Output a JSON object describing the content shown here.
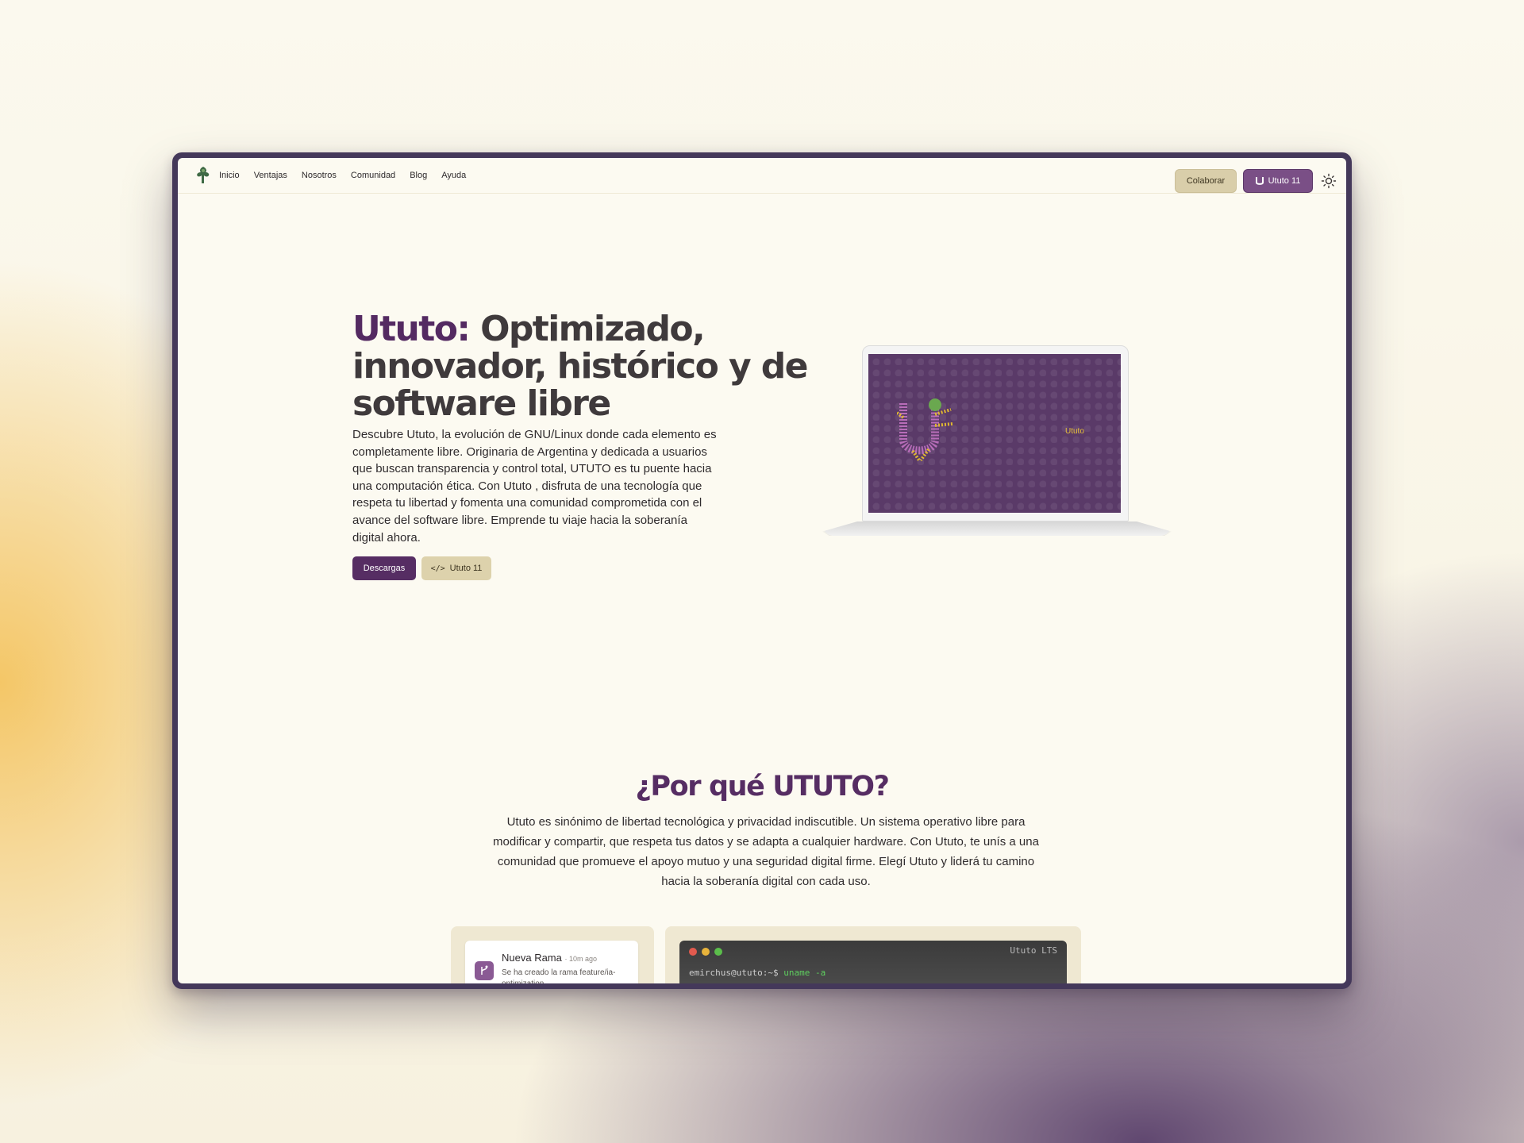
{
  "nav": {
    "logo_icon": "ututo-logo-icon",
    "links": [
      "Inicio",
      "Ventajas",
      "Nosotros",
      "Comunidad",
      "Blog",
      "Ayuda"
    ],
    "colaborar_label": "Colaborar",
    "ututo11_label": "Ututo 11",
    "theme_icon": "sun-icon"
  },
  "hero": {
    "title_accent": "Ututo:",
    "title_rest": "Optimizado, innovador, histórico y de software libre",
    "description": "Descubre Ututo, la evolución de GNU/Linux donde cada elemento es completamente libre. Originaria de Argentina y dedicada a usuarios que buscan transparencia y control total, UTUTO es tu puente hacia una computación ética. Con Ututo , disfruta de una tecnología que respeta tu libertad y fomenta una comunidad comprometida con el avance del software libre. Emprende tu viaje hacia la soberanía digital ahora.",
    "download_label": "Descargas",
    "code_label": "Ututo 11",
    "screen_label": "Ututo"
  },
  "why": {
    "title": "¿Por qué UTUTO?",
    "description": "Ututo es sinónimo de libertad tecnológica y privacidad indiscutible. Un sistema operativo libre para modificar y compartir, que respeta tus datos y se adapta a cualquier hardware. Con Ututo, te unís a una comunidad que promueve el apoyo mutuo y una seguridad digital firme. Elegí Ututo y liderá tu camino hacia la soberanía digital con cada uso."
  },
  "notification": {
    "title": "Nueva Rama",
    "time": "· 10m ago",
    "text": "Se ha creado la rama feature/ia-optimization"
  },
  "terminal": {
    "title": "Ututo LTS",
    "prompt": "emirchus@ututo:~$",
    "command": "uname -a"
  },
  "colors": {
    "accent_purple": "#562d63",
    "button_purple": "#7a4f86",
    "beige": "#d9ceaa",
    "page_bg": "#fcfaf1"
  }
}
